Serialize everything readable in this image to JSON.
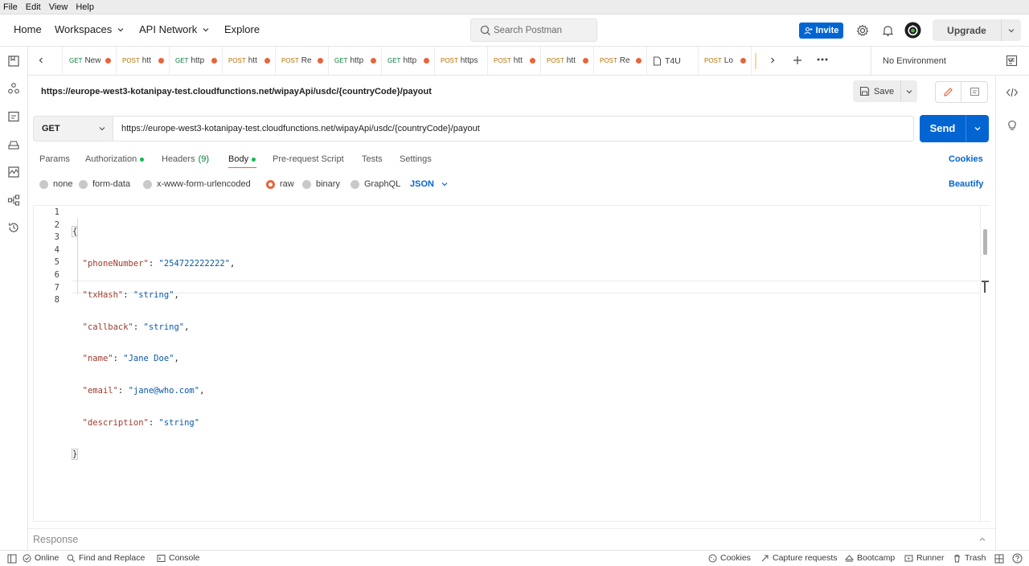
{
  "menubar": {
    "items": [
      "File",
      "Edit",
      "View",
      "Help"
    ]
  },
  "header": {
    "nav": {
      "home": "Home",
      "workspaces": "Workspaces",
      "api_network": "API Network",
      "explore": "Explore"
    },
    "search_placeholder": "Search Postman",
    "invite_label": "Invite",
    "upgrade_label": "Upgrade"
  },
  "tabs": [
    {
      "method": "GET",
      "label": "New",
      "unsaved": true
    },
    {
      "method": "POST",
      "label": "htt",
      "unsaved": true
    },
    {
      "method": "GET",
      "label": "http",
      "unsaved": true
    },
    {
      "method": "POST",
      "label": "htt",
      "unsaved": true
    },
    {
      "method": "POST",
      "label": "Re",
      "unsaved": true
    },
    {
      "method": "GET",
      "label": "http",
      "unsaved": true
    },
    {
      "method": "GET",
      "label": "http",
      "unsaved": true
    },
    {
      "method": "POST",
      "label": "https",
      "unsaved": false
    },
    {
      "method": "POST",
      "label": "htt",
      "unsaved": true
    },
    {
      "method": "POST",
      "label": "htt",
      "unsaved": true
    },
    {
      "method": "POST",
      "label": "Re",
      "unsaved": true
    },
    {
      "method": "",
      "label": "T4U",
      "unsaved": false
    },
    {
      "method": "POST",
      "label": "Lo",
      "unsaved": true
    }
  ],
  "environment": {
    "selected": "No Environment"
  },
  "request": {
    "title": "https://europe-west3-kotanipay-test.cloudfunctions.net/wipayApi/usdc/{countryCode}/payout",
    "method": "GET",
    "url": "https://europe-west3-kotanipay-test.cloudfunctions.net/wipayApi/usdc/{countryCode}/payout",
    "save_label": "Save",
    "send_label": "Send"
  },
  "request_tabs": {
    "params": "Params",
    "authorization": "Authorization",
    "headers": "Headers",
    "headers_count": "(9)",
    "body": "Body",
    "pre_request": "Pre-request Script",
    "tests": "Tests",
    "settings": "Settings",
    "cookies": "Cookies",
    "active": "Body"
  },
  "body_options": {
    "none": "none",
    "form_data": "form-data",
    "urlencoded": "x-www-form-urlencoded",
    "raw": "raw",
    "binary": "binary",
    "graphql": "GraphQL",
    "format": "JSON",
    "beautify": "Beautify",
    "selected": "raw"
  },
  "editor": {
    "line_numbers": [
      "1",
      "2",
      "3",
      "4",
      "5",
      "6",
      "7",
      "8"
    ],
    "lines": [
      {
        "open": "{"
      },
      {
        "key": "\"phoneNumber\"",
        "value": "\"254722222222\"",
        "comma": ","
      },
      {
        "key": "\"txHash\"",
        "value": "\"string\"",
        "comma": ","
      },
      {
        "key": "\"callback\"",
        "value": "\"string\"",
        "comma": ","
      },
      {
        "key": "\"name\"",
        "value": "\"Jane Doe\"",
        "comma": ","
      },
      {
        "key": "\"email\"",
        "value": "\"jane@who.com\"",
        "comma": ","
      },
      {
        "key": "\"description\"",
        "value": "\"string\"",
        "comma": ""
      },
      {
        "close": "}"
      }
    ]
  },
  "response": {
    "label": "Response"
  },
  "statusbar": {
    "online": "Online",
    "find_replace": "Find and Replace",
    "console": "Console",
    "cookies": "Cookies",
    "capture": "Capture requests",
    "bootcamp": "Bootcamp",
    "runner": "Runner",
    "trash": "Trash"
  },
  "colors": {
    "accent": "#e8643a",
    "primary": "#0265d2",
    "get": "#0a7c3a",
    "post": "#b37100"
  }
}
